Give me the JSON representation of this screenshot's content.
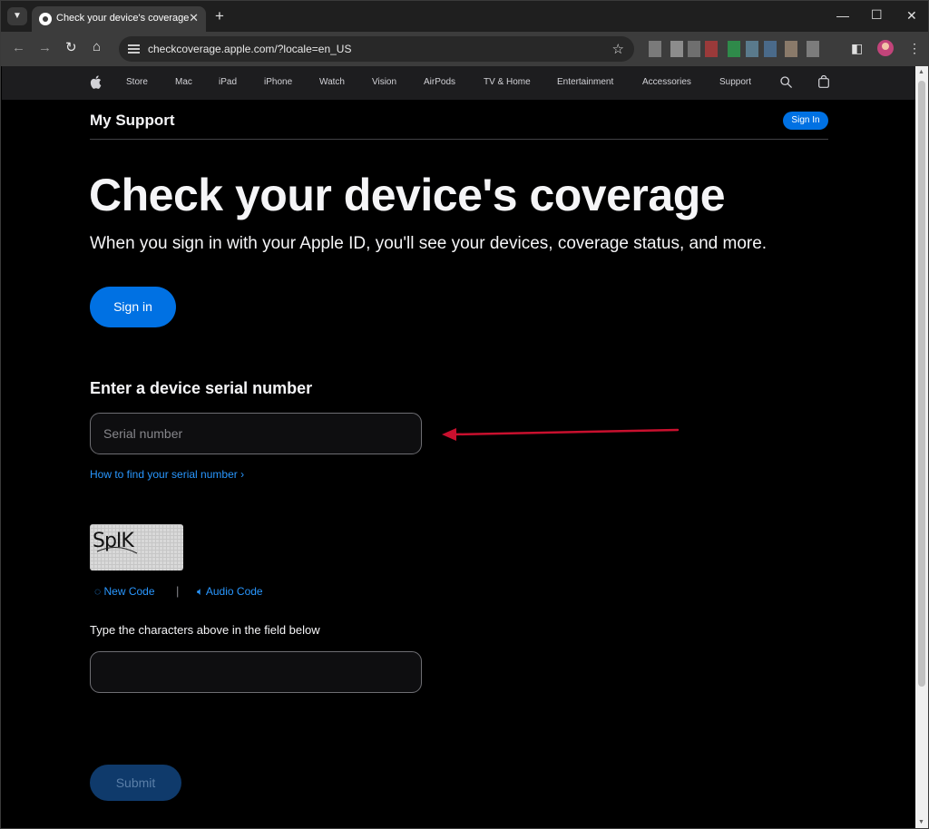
{
  "browser": {
    "tab_title": "Check your device's coverage",
    "url": "checkcoverage.apple.com/?locale=en_US",
    "tab_search_icon": "chevron-down-icon",
    "new_tab_symbol": "+",
    "close_symbol": "✕"
  },
  "globalnav": {
    "items": [
      "Store",
      "Mac",
      "iPad",
      "iPhone",
      "Watch",
      "Vision",
      "AirPods",
      "TV & Home",
      "Entertainment",
      "Accessories",
      "Support"
    ]
  },
  "header": {
    "title": "My Support",
    "sign_in_label": "Sign In"
  },
  "hero": {
    "headline": "Check your device's coverage",
    "subhead": "When you sign in with your Apple ID, you'll see your devices, coverage status, and more.",
    "sign_in_button": "Sign in"
  },
  "serial": {
    "heading": "Enter a device serial number",
    "placeholder": "Serial number",
    "value": "",
    "help_link": "How to find your serial number ›"
  },
  "captcha": {
    "text": "SpIK",
    "new_code": "New Code",
    "separator": "|",
    "audio_code": "Audio Code",
    "instruction": "Type the characters above in the field below",
    "value": ""
  },
  "form": {
    "submit_label": "Submit"
  },
  "colors": {
    "accent": "#0071e3",
    "link": "#2997ff",
    "annotation_arrow": "#c8102e"
  }
}
